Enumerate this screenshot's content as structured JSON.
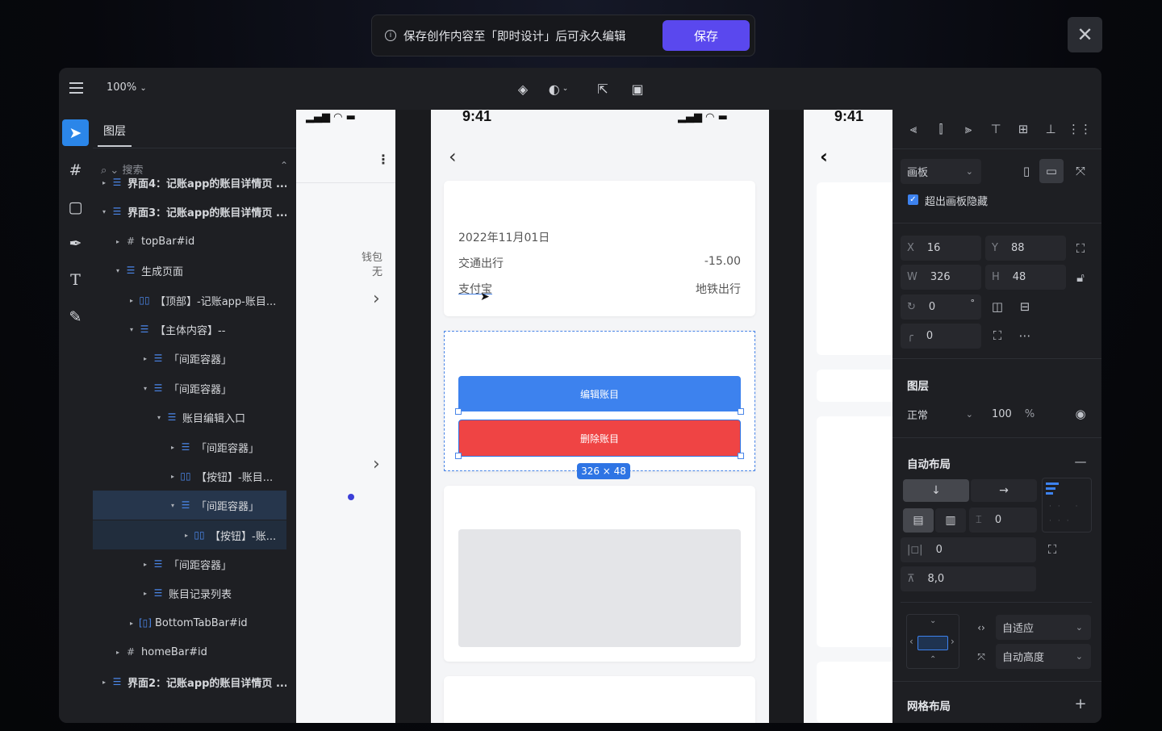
{
  "banner": {
    "text": "保存创作内容至「即时设计」后可永久编辑",
    "save_label": "保存",
    "close": "✕"
  },
  "topbar": {
    "zoom": "100%"
  },
  "layers_panel": {
    "tab": "图层",
    "search_placeholder": "搜索",
    "rows": [
      {
        "label": "界面4：记账app的账目详情页 ...",
        "bold": true
      },
      {
        "label": "界面3：记账app的账目详情页 ...",
        "bold": true
      },
      {
        "label": "topBar#id"
      },
      {
        "label": "生成页面"
      },
      {
        "label": "【顶部】-记账app-账目..."
      },
      {
        "label": "【主体内容】--"
      },
      {
        "label": "「间距容器」"
      },
      {
        "label": "「间距容器」"
      },
      {
        "label": "账目编辑入口"
      },
      {
        "label": "「间距容器」"
      },
      {
        "label": "【按钮】-账目..."
      },
      {
        "label": "「间距容器」"
      },
      {
        "label": "【按钮】-账..."
      },
      {
        "label": "「间距容器」"
      },
      {
        "label": "账目记录列表"
      },
      {
        "label": "BottomTabBar#id"
      },
      {
        "label": "homeBar#id"
      },
      {
        "label": "界面2：记账app的账目详情页 ...",
        "bold": true
      }
    ]
  },
  "canvas": {
    "left_phone": {
      "wallet": "钱包",
      "none": "无"
    },
    "center_phone": {
      "time": "9:41",
      "date": "2022年11月01日",
      "category": "交通出行",
      "amount": "-15.00",
      "payment": "支付宝",
      "note": "地铁出行",
      "edit_button": "编辑账目",
      "delete_button": "删除账目",
      "selection_size": "326 × 48"
    },
    "right_phone": {
      "time": "9:41"
    }
  },
  "inspector": {
    "frame_type": "画板",
    "clip_label": "超出画板隐藏",
    "x": "16",
    "y": "88",
    "w": "326",
    "h": "48",
    "rotation": "0",
    "rotation_unit": "°",
    "radius": "0",
    "layer_title": "图层",
    "blend": "正常",
    "opacity": "100",
    "opacity_unit": "%",
    "autolayout_title": "自动布局",
    "gap": "0",
    "padding_h": "0",
    "padding_v": "8,0",
    "width_mode": "自适应",
    "height_mode": "自动高度",
    "grid_title": "网格布局"
  }
}
